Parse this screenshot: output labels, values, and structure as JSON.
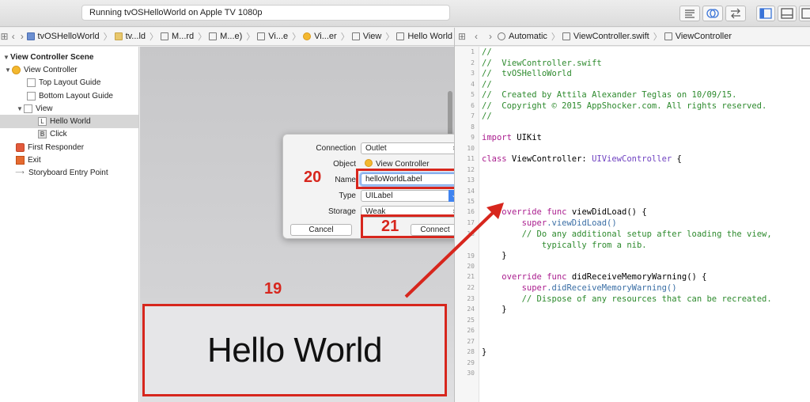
{
  "toolbar": {
    "status": "Running tvOSHelloWorld on Apple TV 1080p"
  },
  "left_jumpbar": {
    "crumbs": [
      "tvOSHelloWorld",
      "tv...ld",
      "M...rd",
      "M...e)",
      "Vi...e",
      "Vi...er",
      "View",
      "Hello World"
    ]
  },
  "right_jumpbar": {
    "crumbs": [
      "Automatic",
      "ViewController.swift",
      "ViewController"
    ]
  },
  "outline": {
    "items": [
      {
        "label": "View Controller Scene",
        "icon": "scene-triangle",
        "bold": true
      },
      {
        "label": "View Controller",
        "icon": "view-controller-icon"
      },
      {
        "label": "Top Layout Guide",
        "icon": "layout-guide-icon"
      },
      {
        "label": "Bottom Layout Guide",
        "icon": "layout-guide-icon"
      },
      {
        "label": "View",
        "icon": "view-icon"
      },
      {
        "label": "Hello World",
        "icon": "label-icon",
        "badge": "L"
      },
      {
        "label": "Click",
        "icon": "button-icon",
        "badge": "B"
      },
      {
        "label": "First Responder",
        "icon": "first-responder-icon"
      },
      {
        "label": "Exit",
        "icon": "exit-icon"
      },
      {
        "label": "Storyboard Entry Point",
        "icon": "entry-arrow-icon"
      }
    ]
  },
  "canvas": {
    "label_text": "Hello World"
  },
  "popover": {
    "connection_label": "Connection",
    "connection_value": "Outlet",
    "object_label": "Object",
    "object_value": "View Controller",
    "name_label": "Name",
    "name_value": "helloWorldLabel",
    "type_label": "Type",
    "type_value": "UILabel",
    "storage_label": "Storage",
    "storage_value": "Weak",
    "cancel_label": "Cancel",
    "connect_label": "Connect"
  },
  "annotations": {
    "step_19": "19",
    "step_20": "20",
    "step_21": "21",
    "color": "#d7261d"
  },
  "editor": {
    "line_numbers": [
      "1",
      "2",
      "3",
      "4",
      "5",
      "6",
      "7",
      "8",
      "9",
      "10",
      "11",
      "12",
      "13",
      "14",
      "15",
      "16",
      "17",
      "18",
      "19",
      "20",
      "21",
      "22",
      "23",
      "24",
      "25",
      "26",
      "27",
      "28",
      "29",
      "30"
    ],
    "header": {
      "l1": "//",
      "l2": "//  ViewController.swift",
      "l3": "//  tvOSHelloWorld",
      "l4": "//",
      "l5": "//  Created by Attila Alexander Teglas on 10/09/15.",
      "l6": "//  Copyright © 2015 AppShocker.com. All rights reserved.",
      "l7": "//"
    },
    "kw_import": "import",
    "import_module": " UIKit",
    "kw_class": "class",
    "class_decl": " ViewController: ",
    "superclass": "UIViewController",
    "open_brace": " {",
    "kw_override": "override",
    "kw_func": "func",
    "func1_name": " viewDidLoad() {",
    "kw_super": "super",
    "call1": ".viewDidLoad()",
    "comment1a": "// Do any additional setup after loading the view,",
    "comment1b": "typically from a nib.",
    "close_brace": "}",
    "func2_name": " didReceiveMemoryWarning() {",
    "call2": ".didReceiveMemoryWarning()",
    "comment2": "// Dispose of any resources that can be recreated."
  }
}
